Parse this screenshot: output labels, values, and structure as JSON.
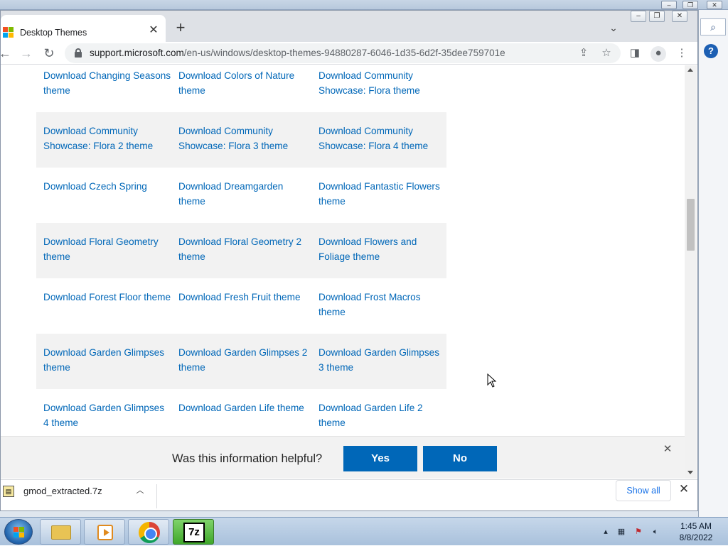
{
  "browser": {
    "tab_title": "Desktop Themes",
    "url_host": "support.microsoft.com",
    "url_path": "/en-us/windows/desktop-themes-94880287-6046-1d35-6d2f-35dee759701e"
  },
  "themes": [
    [
      "Download Changing Seasons theme",
      "Download Colors of Nature theme",
      "Download Community Showcase: Flora theme"
    ],
    [
      "Download Community Showcase: Flora 2 theme",
      "Download Community Showcase: Flora 3 theme",
      "Download Community Showcase: Flora 4 theme"
    ],
    [
      "Download Czech Spring",
      "Download Dreamgarden theme",
      "Download Fantastic Flowers theme"
    ],
    [
      "Download Floral Geometry theme",
      "Download Floral Geometry 2 theme",
      "Download Flowers and Foliage theme"
    ],
    [
      "Download Forest Floor theme",
      "Download Fresh Fruit theme",
      "Download Frost Macros theme"
    ],
    [
      "Download Garden Glimpses theme",
      "Download Garden Glimpses 2 theme",
      "Download Garden Glimpses 3 theme"
    ],
    [
      "Download Garden Glimpses 4 theme",
      "Download Garden Life theme",
      "Download Garden Life 2 theme"
    ]
  ],
  "feedback": {
    "question": "Was this information helpful?",
    "yes": "Yes",
    "no": "No"
  },
  "downloads": {
    "file_name": "gmod_extracted.7z",
    "show_all": "Show all"
  },
  "taskbar": {
    "time": "1:45 AM",
    "date": "8/8/2022",
    "seven_zip_label": "7z"
  },
  "colors": {
    "link": "#0067b8",
    "button": "#0067b8",
    "row_shade": "#f2f2f2"
  }
}
